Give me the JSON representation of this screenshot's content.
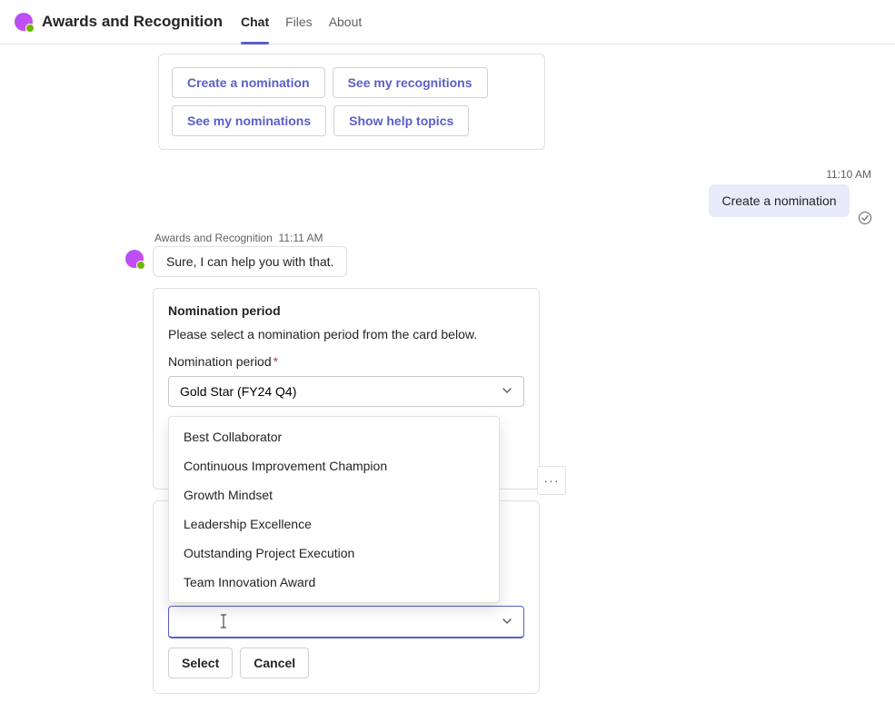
{
  "header": {
    "title": "Awards and Recognition",
    "tabs": {
      "chat": "Chat",
      "files": "Files",
      "about": "About"
    }
  },
  "quick_actions": {
    "create": "Create a nomination",
    "see_recognitions": "See my recognitions",
    "see_nominations": "See my nominations",
    "help": "Show help topics"
  },
  "user_message": {
    "timestamp": "11:10 AM",
    "text": "Create a nomination"
  },
  "bot": {
    "name": "Awards and Recognition",
    "timestamp": "11:11 AM",
    "reply": "Sure, I can help you with that."
  },
  "form": {
    "heading": "Nomination period",
    "subtext": "Please select a nomination period from the card below.",
    "label": "Nomination period",
    "selected_value": "Gold Star (FY24 Q4)",
    "select_btn": "Select",
    "cancel_btn": "Cancel",
    "input_value": ""
  },
  "dropdown_options": [
    "Best Collaborator",
    "Continuous Improvement Champion",
    "Growth Mindset",
    "Leadership Excellence",
    "Outstanding Project Execution",
    "Team Innovation Award"
  ],
  "icons": {
    "more": "···"
  }
}
